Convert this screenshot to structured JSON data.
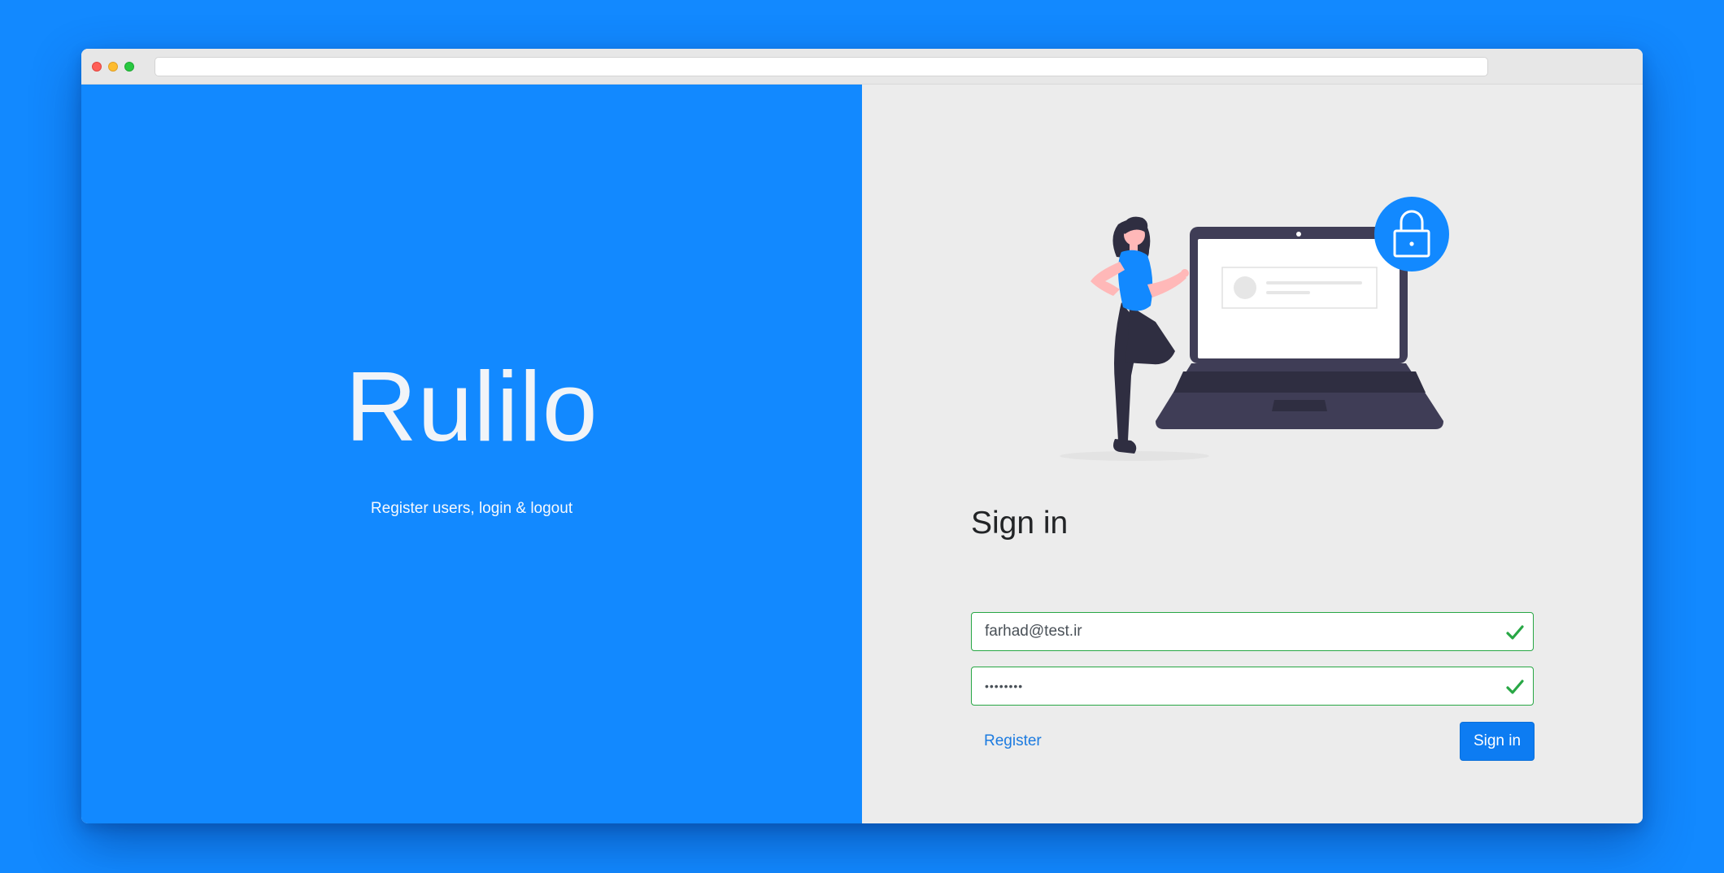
{
  "brand": {
    "title": "Rulilo",
    "subtitle": "Register users, login & logout"
  },
  "signin": {
    "heading": "Sign in",
    "email_value": "farhad@test.ir",
    "password_value": "password",
    "register_label": "Register",
    "submit_label": "Sign in"
  },
  "icons": {
    "window_controls": [
      "close-dot",
      "minimize-dot",
      "zoom-dot"
    ],
    "validation": "checkmark-icon",
    "illustration": "woman-with-laptop-lock-illustration",
    "lock": "lock-icon"
  },
  "colors": {
    "brand_blue": "#1289ff",
    "panel_gray": "#ececec",
    "valid_green": "#28a745",
    "button_blue": "#0d7cf2",
    "link_blue": "#1c7be0"
  }
}
